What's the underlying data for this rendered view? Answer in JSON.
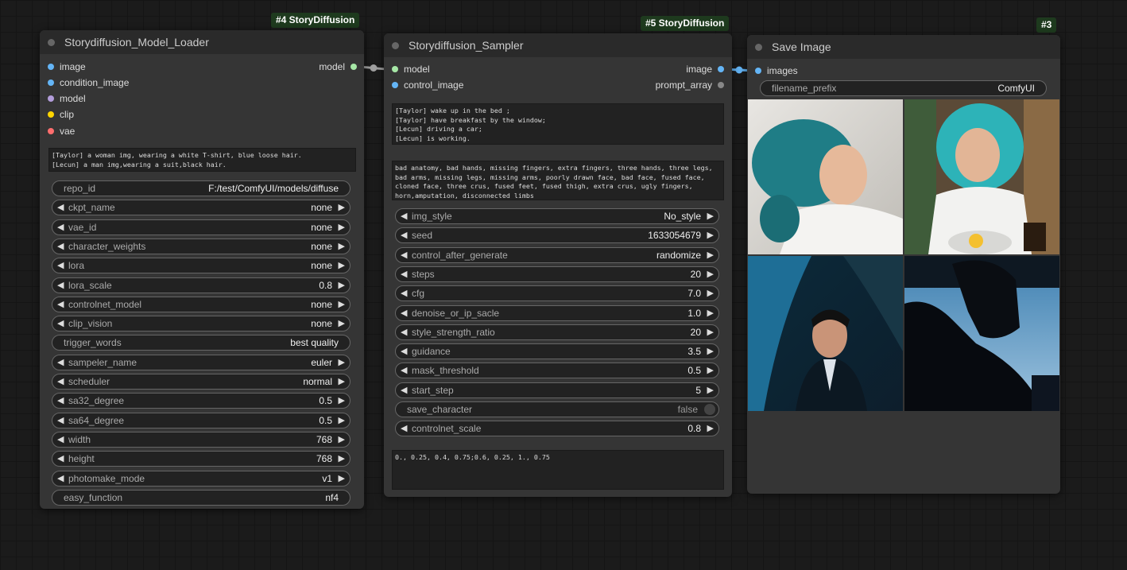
{
  "colors": {
    "model": "#a6e7a6",
    "image": "#64b5f6",
    "clip": "#ffd500",
    "vae": "#ff6e6e",
    "condition_image": "#64b5f6",
    "model_purple": "#b39ddb"
  },
  "badges": {
    "node4": "#4 StoryDiffusion",
    "node5": "#5 StoryDiffusion",
    "node3": "#3"
  },
  "loader": {
    "title": "Storydiffusion_Model_Loader",
    "inputs": [
      "image",
      "condition_image",
      "model",
      "clip",
      "vae"
    ],
    "output": "model",
    "prompt": "[Taylor] a woman img, wearing a white T-shirt, blue loose hair.\n[Lecun] a man img,wearing a suit,black hair.",
    "widgets": [
      {
        "label": "repo_id",
        "value": "F:/test/ComfyUI/models/diffuse"
      },
      {
        "label": "ckpt_name",
        "value": "none"
      },
      {
        "label": "vae_id",
        "value": "none"
      },
      {
        "label": "character_weights",
        "value": "none"
      },
      {
        "label": "lora",
        "value": "none"
      },
      {
        "label": "lora_scale",
        "value": "0.8"
      },
      {
        "label": "controlnet_model",
        "value": "none"
      },
      {
        "label": "clip_vision",
        "value": "none"
      },
      {
        "label": "trigger_words",
        "value": "best quality"
      },
      {
        "label": "sampeler_name",
        "value": "euler"
      },
      {
        "label": "scheduler",
        "value": "normal"
      },
      {
        "label": "sa32_degree",
        "value": "0.5"
      },
      {
        "label": "sa64_degree",
        "value": "0.5"
      },
      {
        "label": "width",
        "value": "768"
      },
      {
        "label": "height",
        "value": "768"
      },
      {
        "label": "photomake_mode",
        "value": "v1"
      },
      {
        "label": "easy_function",
        "value": "nf4"
      }
    ]
  },
  "sampler": {
    "title": "Storydiffusion_Sampler",
    "inputs": [
      "model",
      "control_image"
    ],
    "outputs": [
      "image",
      "prompt_array"
    ],
    "prompt": "[Taylor] wake up in the bed ;\n[Taylor] have breakfast by the window;\n[Lecun] driving a car;\n[Lecun] is working.",
    "negative": "bad anatomy, bad hands, missing fingers, extra fingers, three hands, three legs, bad arms, missing legs, missing arms, poorly drawn face, bad face, fused face, cloned face, three crus, fused feet, fused thigh, extra crus, ugly fingers, horn,amputation, disconnected limbs",
    "widgets": [
      {
        "label": "img_style",
        "value": "No_style"
      },
      {
        "label": "seed",
        "value": "1633054679"
      },
      {
        "label": "control_after_generate",
        "value": "randomize"
      },
      {
        "label": "steps",
        "value": "20"
      },
      {
        "label": "cfg",
        "value": "7.0"
      },
      {
        "label": "denoise_or_ip_sacle",
        "value": "1.0"
      },
      {
        "label": "style_strength_ratio",
        "value": "20"
      },
      {
        "label": "guidance",
        "value": "3.5"
      },
      {
        "label": "mask_threshold",
        "value": "0.5"
      },
      {
        "label": "start_step",
        "value": "5"
      },
      {
        "label": "save_character",
        "value": "false"
      },
      {
        "label": "controlnet_scale",
        "value": "0.8"
      }
    ],
    "extra_text": "0., 0.25, 0.4, 0.75;0.6, 0.25, 1., 0.75"
  },
  "save": {
    "title": "Save Image",
    "input": "images",
    "filename_label": "filename_prefix",
    "filename_value": "ComfyUI"
  }
}
